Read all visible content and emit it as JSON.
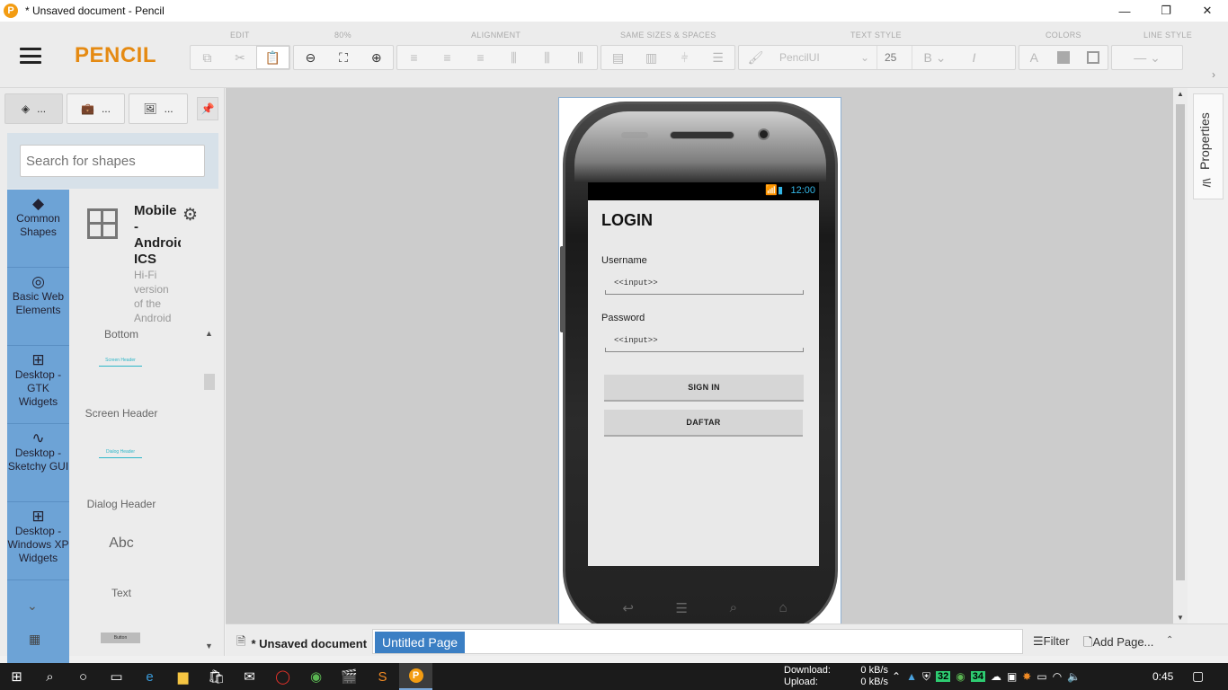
{
  "window": {
    "title": "* Unsaved document - Pencil",
    "app_icon": "P",
    "minimize": "—",
    "maximize": "❐",
    "close": "✕"
  },
  "toolbar": {
    "brand": "PENCIL",
    "groups": {
      "edit": "EDIT",
      "zoom": "80%",
      "alignment": "ALIGNMENT",
      "same_sizes": "SAME SIZES & SPACES",
      "text_style": "TEXT STYLE",
      "colors": "COLORS",
      "line_style": "LINE STYLE"
    },
    "font_family": "PencilUI",
    "font_size": "25",
    "bold_label": "B",
    "italic_label": "I",
    "font_color_label": "A",
    "more_arrow": "›"
  },
  "left_panel": {
    "tabs": [
      {
        "label": "...",
        "icon": "layers-icon"
      },
      {
        "label": "...",
        "icon": "briefcase-icon"
      },
      {
        "label": "...",
        "icon": "image-icon"
      }
    ],
    "search_placeholder": "Search for shapes",
    "categories": [
      {
        "label": "Common Shapes",
        "icon": "◆"
      },
      {
        "label": "Basic Web Elements",
        "icon": "◎"
      },
      {
        "label": "Desktop - GTK Widgets",
        "icon": "⊞"
      },
      {
        "label": "Desktop - Sketchy GUI",
        "icon": "∿"
      },
      {
        "label": "Desktop - Windows XP Widgets",
        "icon": "⊞"
      }
    ],
    "collection": {
      "title": "Mobile - Android ICS",
      "description": "Hi-Fi version of the Android"
    },
    "shapes": {
      "bottom": "Bottom",
      "screen_header_preview": "Screen Header",
      "screen_header": "Screen Header",
      "dialog_header_preview": "Dialog Header",
      "dialog_header": "Dialog Header",
      "text_preview": "Abc",
      "text": "Text",
      "button_preview": "Button"
    }
  },
  "phone_screen": {
    "time": "12:00",
    "title": "LOGIN",
    "username_label": "Username",
    "username_input": "<<input>>",
    "password_label": "Password",
    "password_input": "<<input>>",
    "signin_button": "SIGN IN",
    "register_button": "DAFTAR"
  },
  "right_panel": {
    "properties_label": "Properties"
  },
  "page_bar": {
    "document_name": "* Unsaved document",
    "page_tab": "Untitled Page",
    "filter": "Filter",
    "add_page": "Add Page..."
  },
  "taskbar": {
    "download_label": "Download:",
    "download_value": "0 kB/s",
    "upload_label": "Upload:",
    "upload_value": "0 kB/s",
    "badge_1": "32",
    "badge_2": "34",
    "clock": "0:45"
  }
}
